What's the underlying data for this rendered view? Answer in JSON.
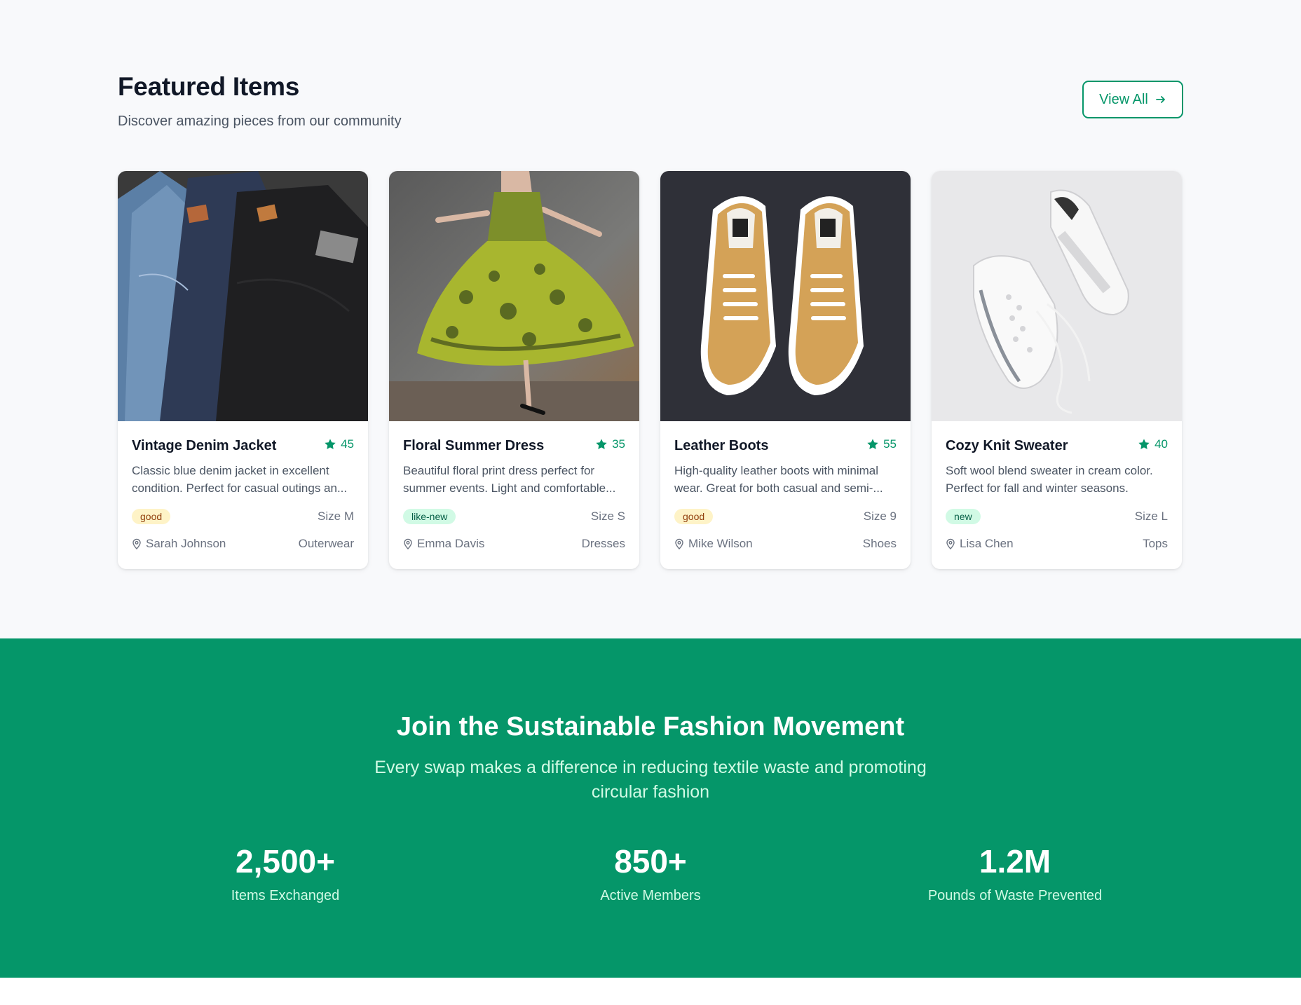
{
  "featured": {
    "title": "Featured Items",
    "subtitle": "Discover amazing pieces from our community",
    "view_all_label": "View All"
  },
  "colors": {
    "brand_green": "#059669",
    "badge_good_bg": "#fef3c7",
    "badge_new_bg": "#d1fae5"
  },
  "items": [
    {
      "title": "Vintage Denim Jacket",
      "rating": "45",
      "description": "Classic blue denim jacket in excellent condition. Perfect for casual outings an...",
      "condition": "good",
      "size": "Size M",
      "owner": "Sarah Johnson",
      "category": "Outerwear",
      "image": "denim-jeans-photo"
    },
    {
      "title": "Floral Summer Dress",
      "rating": "35",
      "description": "Beautiful floral print dress perfect for summer events. Light and comfortable...",
      "condition": "like-new",
      "size": "Size S",
      "owner": "Emma Davis",
      "category": "Dresses",
      "image": "green-floral-dress-photo"
    },
    {
      "title": "Leather Boots",
      "rating": "55",
      "description": "High-quality leather boots with minimal wear. Great for both casual and semi-...",
      "condition": "good",
      "size": "Size 9",
      "owner": "Mike Wilson",
      "category": "Shoes",
      "image": "tan-sneakers-photo"
    },
    {
      "title": "Cozy Knit Sweater",
      "rating": "40",
      "description": "Soft wool blend sweater in cream color. Perfect for fall and winter seasons.",
      "condition": "new",
      "size": "Size L",
      "owner": "Lisa Chen",
      "category": "Tops",
      "image": "white-running-shoes-photo"
    }
  ],
  "movement": {
    "title": "Join the Sustainable Fashion Movement",
    "subtitle": "Every swap makes a difference in reducing textile waste and promoting circular fashion",
    "stats": [
      {
        "value": "2,500+",
        "label": "Items Exchanged"
      },
      {
        "value": "850+",
        "label": "Active Members"
      },
      {
        "value": "1.2M",
        "label": "Pounds of Waste Prevented"
      }
    ]
  }
}
